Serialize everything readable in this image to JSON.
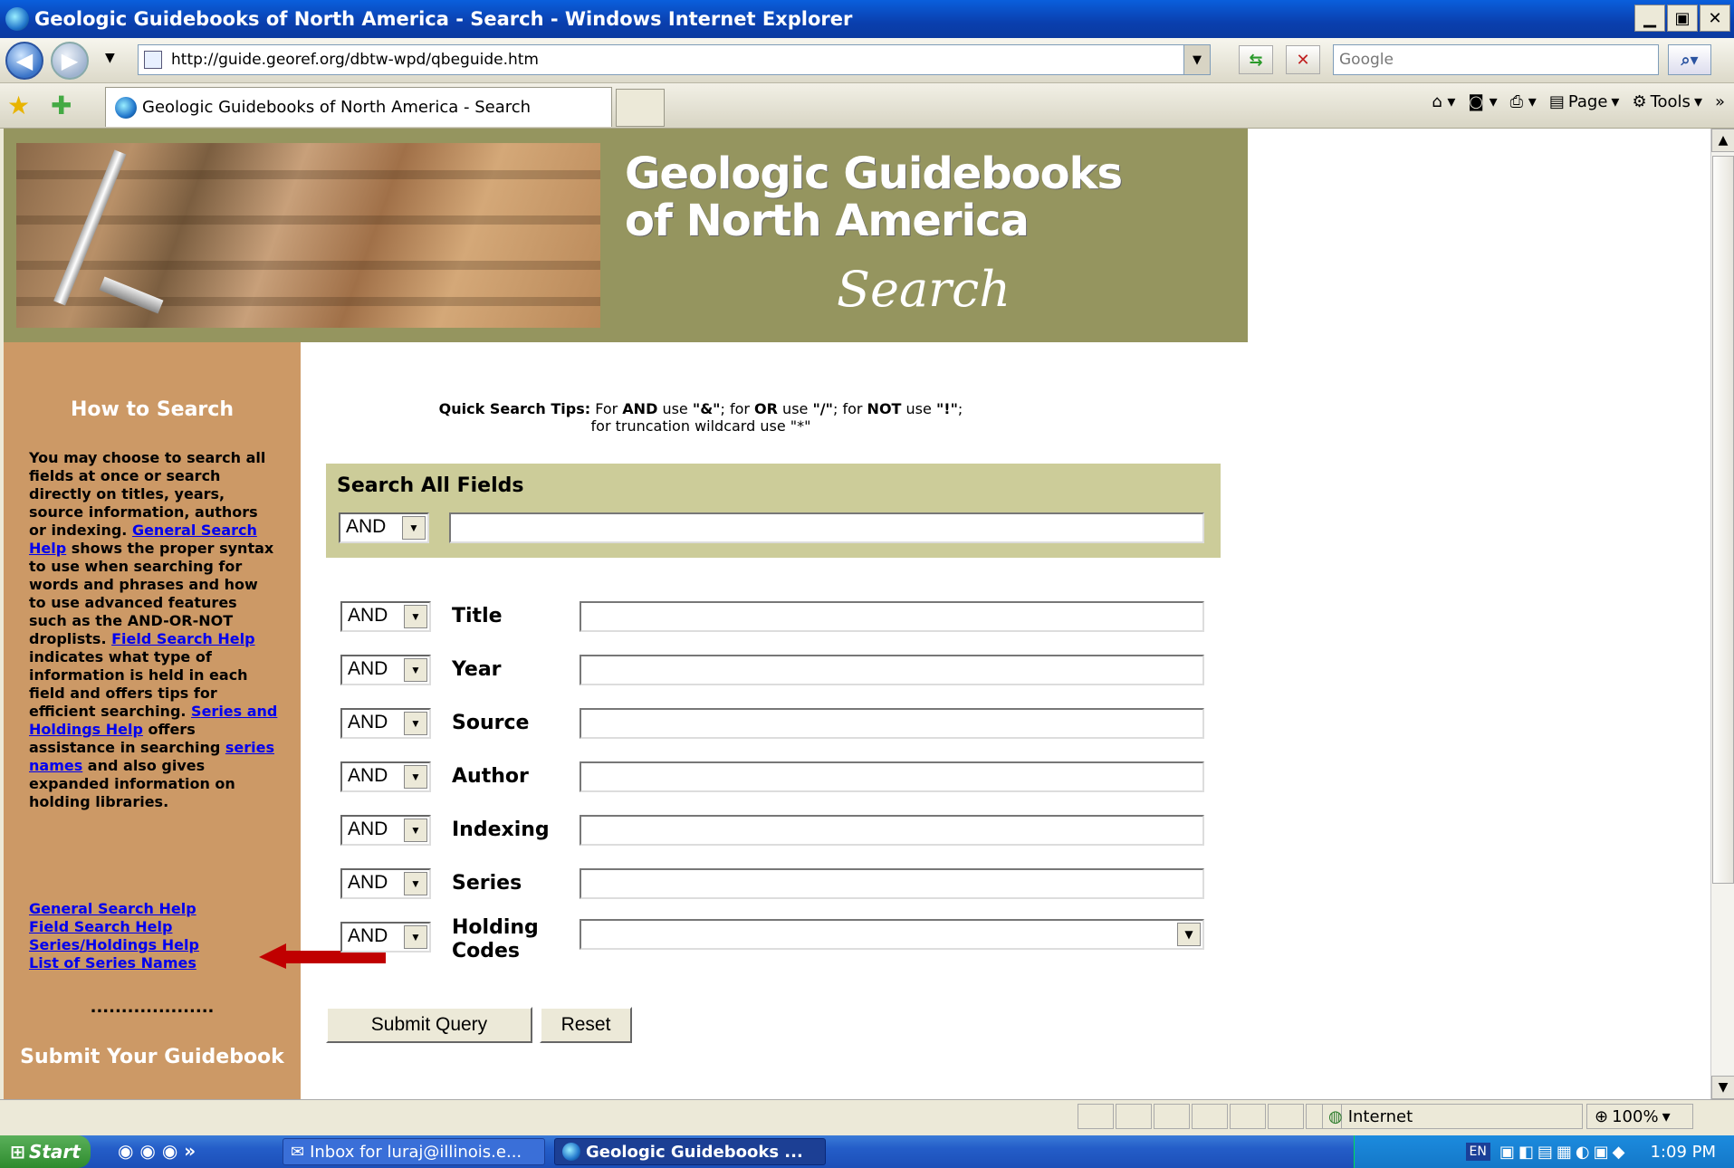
{
  "window": {
    "title": "Geologic Guidebooks of North America - Search - Windows Internet Explorer",
    "controls": [
      "▁",
      "▣",
      "✕"
    ]
  },
  "address": {
    "url": "http://guide.georef.org/dbtw-wpd/qbeguide.htm",
    "search_placeholder": "Google"
  },
  "tab": {
    "label": "Geologic Guidebooks of North America - Search"
  },
  "command_bar": {
    "page": "Page",
    "tools": "Tools"
  },
  "banner": {
    "title_line1": "Geologic Guidebooks",
    "title_line2": "of North America",
    "subtitle": "Search"
  },
  "sidebar": {
    "heading": "How to Search",
    "desc_part1": "You may choose to search all fields at once or search directly on titles, years, source information, authors or indexing. ",
    "link_general_inline": "General Search Help",
    "desc_part2": " shows the proper syntax to use when searching for words and phrases and how to use advanced features such as the AND-OR-NOT droplists. ",
    "link_field_inline": "Field Search Help",
    "desc_part3": " indicates what type of information is held in each field and offers tips for efficient searching. ",
    "link_series_inline": "Series and Holdings Help",
    "desc_part4": " offers assistance in searching ",
    "link_series_names_inline": "series names",
    "desc_part5": " and also gives expanded information on holding libraries.",
    "links": [
      "General Search Help",
      "Field Search Help",
      "Series/Holdings Help",
      "List of Series Names"
    ],
    "dots": "....................",
    "submit_heading": "Submit Your Guidebook"
  },
  "tips": {
    "lead": "Quick Search Tips:",
    "t1": " For ",
    "and": "AND",
    "t2": " use ",
    "amp": "\"&\"",
    "t3": "; for ",
    "or": "OR",
    "t4": " use ",
    "slash": "\"/\"",
    "t5": "; for ",
    "not": "NOT",
    "t6": " use ",
    "bang": "\"!\"",
    "t7": ";",
    "line2": "for truncation wildcard use \"*\""
  },
  "form": {
    "all_fields_heading": "Search All Fields",
    "operator": "AND",
    "fields": [
      "Title",
      "Year",
      "Source",
      "Author",
      "Indexing",
      "Series"
    ],
    "holding_label_line1": "Holding",
    "holding_label_line2": "Codes",
    "submit": "Submit Query",
    "reset": "Reset"
  },
  "status": {
    "zone": "Internet",
    "zoom": "100%"
  },
  "taskbar": {
    "start": "Start",
    "task1": "Inbox for luraj@illinois.e...",
    "task2": "Geologic Guidebooks ...",
    "lang": "EN",
    "clock": "1:09 PM"
  },
  "colors": {
    "banner": "#95955f",
    "sidebar": "#cc9966",
    "search_all_box": "#cccc99",
    "arrow": "#c00000"
  }
}
